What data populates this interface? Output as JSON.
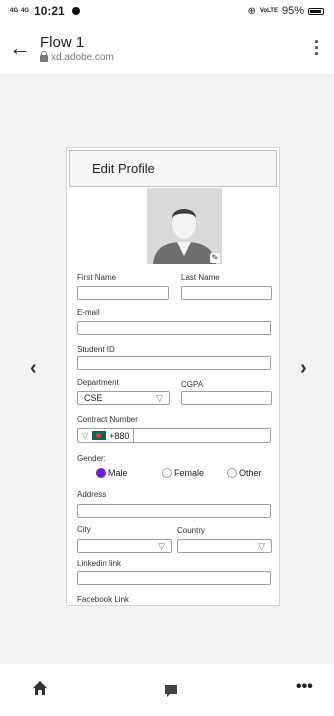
{
  "status_bar": {
    "signal_1": "4G",
    "signal_2": "4G",
    "time": "10:21",
    "right_info": "VoLTE",
    "battery": "95%"
  },
  "browser": {
    "title": "Flow 1",
    "url": "xd.adobe.com"
  },
  "form": {
    "header": "Edit Profile",
    "first_name_label": "First Name",
    "last_name_label": "Last Name",
    "email_label": "E-mail",
    "student_id_label": "Student ID",
    "department_label": "Department",
    "department_value": "CSE",
    "cgpa_label": "CGPA",
    "contact_label": "Contract Number",
    "phone_code": "+880",
    "gender_label": "Gender:",
    "gender_options": [
      "Male",
      "Female",
      "Other"
    ],
    "gender_selected": "Male",
    "address_label": "Address",
    "city_label": "City",
    "country_label": "Country",
    "linkedin_label": "Linkedin link",
    "facebook_label": "Facebook Link"
  },
  "colors": {
    "accent": "#6a1fd8",
    "flag_green": "#006a4e",
    "flag_red": "#f42a41"
  }
}
